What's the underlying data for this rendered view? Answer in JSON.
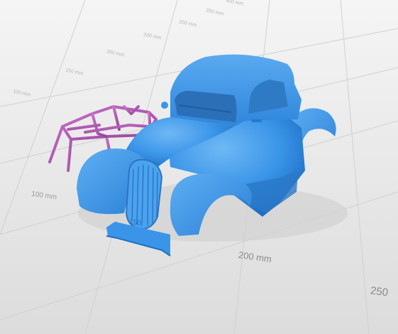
{
  "scale_labels": {
    "top_300": "300 mm",
    "top_250": "250 mm",
    "top_200": "200 mm",
    "top_150": "150 mm",
    "top_100": "100 mm",
    "left_100": "100 mm",
    "left_150": "150",
    "bottom_200": "200 mm",
    "bottom_250": "250"
  },
  "colors": {
    "body": "#3a95e8",
    "roll_cage": "#b257b6",
    "floor": "#e4e4e4",
    "grid": "#cfcfcf"
  }
}
